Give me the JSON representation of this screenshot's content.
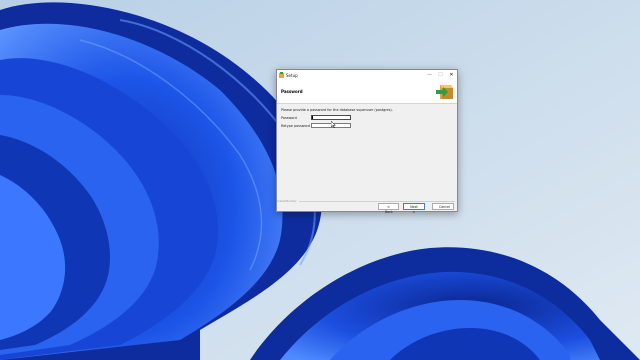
{
  "window": {
    "title": "Setup",
    "controls": {
      "minimize": "—",
      "maximize": "☐",
      "close": "✕"
    }
  },
  "header": {
    "title": "Password",
    "logo_icon": "installer-box-arrow-icon"
  },
  "content": {
    "prompt": "Please provide a password for the database superuser (postgres).",
    "password": {
      "label": "Password",
      "value": ""
    },
    "retype_password": {
      "label": "Retype password",
      "value": ""
    }
  },
  "footer": {
    "brand": "InstallBuilder",
    "buttons": {
      "back": "< Back",
      "next": "Next >",
      "cancel": "Cancel"
    }
  },
  "colors": {
    "wallpaper_sky": "#c9dcec",
    "wallpaper_blue": "#1f4fe0",
    "dialog_bg": "#f0f0f0",
    "accent": "#3c7fd1"
  }
}
